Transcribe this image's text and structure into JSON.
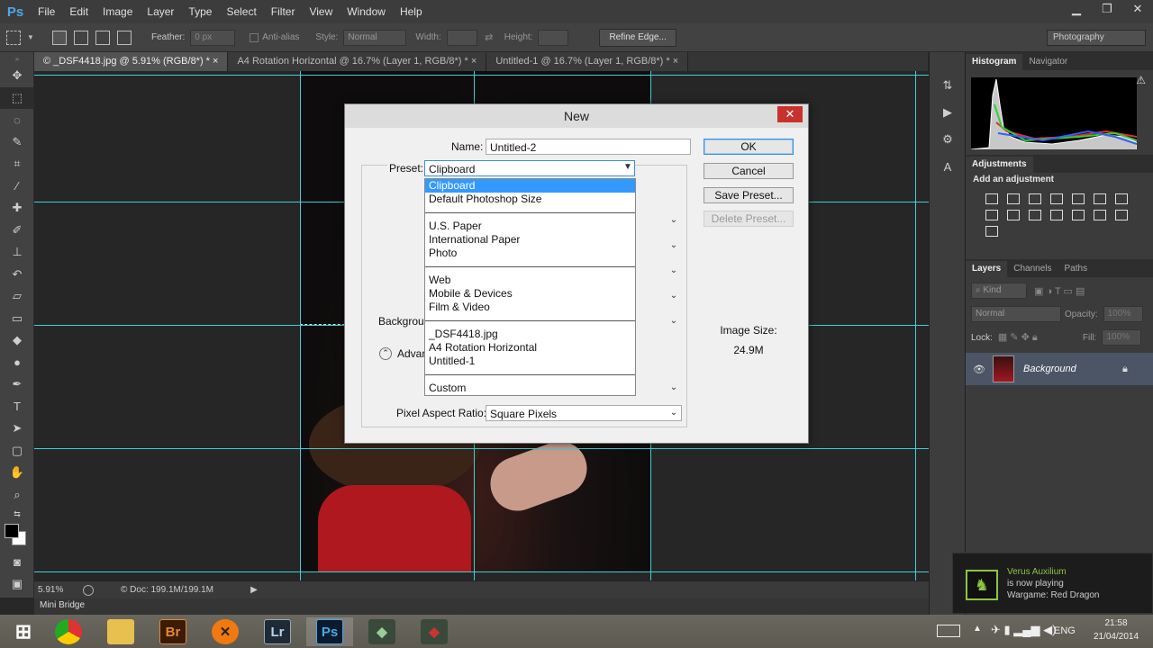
{
  "app": {
    "logo": "Ps"
  },
  "menu": [
    "File",
    "Edit",
    "Image",
    "Layer",
    "Type",
    "Select",
    "Filter",
    "View",
    "Window",
    "Help"
  ],
  "options_bar": {
    "feather_label": "Feather:",
    "feather_value": "0 px",
    "antialias_label": "Anti-alias",
    "style_label": "Style:",
    "style_value": "Normal",
    "width_label": "Width:",
    "height_label": "Height:",
    "refine_edge": "Refine Edge...",
    "workspace": "Photography"
  },
  "tabs": [
    {
      "label": "© _DSF4418.jpg @ 5.91% (RGB/8*) *"
    },
    {
      "label": "A4 Rotation Horizontal @ 16.7% (Layer 1, RGB/8*) *"
    },
    {
      "label": "Untitled-1 @ 16.7% (Layer 1, RGB/8*) *"
    }
  ],
  "status": {
    "zoom": "5.91%",
    "doc": "Doc: 199.1M/199.1M"
  },
  "minibridge": "Mini Bridge",
  "panels": {
    "histogram_tabs": [
      "Histogram",
      "Navigator"
    ],
    "adjustments_title": "Adjustments",
    "add_adjustment": "Add an adjustment",
    "layers_tabs": [
      "Layers",
      "Channels",
      "Paths"
    ],
    "kind": "Kind",
    "blend_mode": "Normal",
    "opacity_label": "Opacity:",
    "opacity_value": "100%",
    "lock_label": "Lock:",
    "fill_label": "Fill:",
    "fill_value": "100%",
    "layer_name": "Background"
  },
  "dialog": {
    "title": "New",
    "name_label": "Name:",
    "name_value": "Untitled-2",
    "preset_label": "Preset:",
    "preset_value": "Clipboard",
    "ok": "OK",
    "cancel": "Cancel",
    "save_preset": "Save Preset...",
    "delete_preset": "Delete Preset...",
    "background_label": "Backgrour",
    "advanced_label": "Advan",
    "image_size_label": "Image Size:",
    "image_size_value": "24.9M",
    "pixel_aspect_label": "Pixel Aspect Ratio:",
    "pixel_aspect_value": "Square Pixels",
    "dropdown_groups": [
      [
        "Clipboard",
        "Default Photoshop Size"
      ],
      [
        "U.S. Paper",
        "International Paper",
        "Photo"
      ],
      [
        "Web",
        "Mobile & Devices",
        "Film & Video"
      ],
      [
        "_DSF4418.jpg",
        "A4 Rotation Horizontal",
        "Untitled-1"
      ],
      [
        "Custom"
      ]
    ]
  },
  "notification": {
    "name": "Verus Auxilium",
    "status": "is now playing",
    "game": "Wargame: Red Dragon"
  },
  "tray": {
    "lang": "ENG",
    "time": "21:58",
    "date": "21/04/2014"
  },
  "taskbar_apps": [
    "Br",
    "Lr",
    "Ps"
  ],
  "colors": {
    "guide": "#3fd0d8",
    "ps_blue": "#4aa8e8",
    "dialog_close": "#c7332c",
    "selection": "#3399ff"
  }
}
